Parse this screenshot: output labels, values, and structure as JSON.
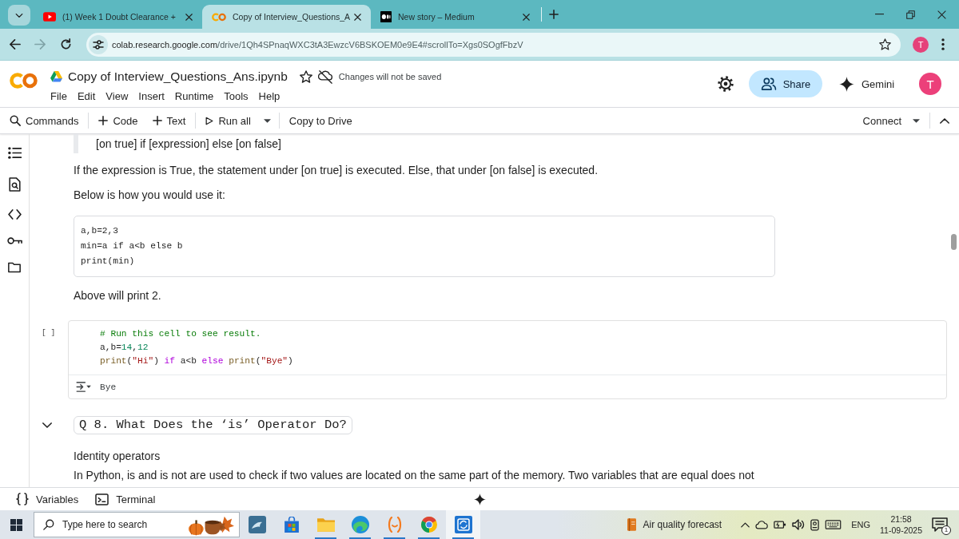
{
  "browser": {
    "tabs": [
      {
        "kind": "video",
        "title": "(1) Week 1 Doubt Clearance +",
        "selected": false
      },
      {
        "kind": "notebook",
        "title": "Copy of Interview_Questions_A",
        "selected": true
      },
      {
        "kind": "story",
        "title": "New story – Medium",
        "selected": false
      }
    ],
    "nav": [
      {
        "kind": "back",
        "disabled": false
      },
      {
        "kind": "forward",
        "disabled": true
      },
      {
        "kind": "reload",
        "disabled": false
      }
    ],
    "address": {
      "host": "colab.research.google.com",
      "path": "/drive/1Qh4SPnaqWXC3tA3EwzcV6BSKOEM0e9E4#scrollTo=Xgs0SOgfFbzV"
    },
    "profile_initial": "T"
  },
  "notebook": {
    "title": "Copy of Interview_Questions_Ans.ipynb",
    "save_status": "Changes will not be saved",
    "menu": [
      "File",
      "Edit",
      "View",
      "Insert",
      "Runtime",
      "Tools",
      "Help"
    ],
    "share": "Share",
    "gemini": "Gemini",
    "avatar_initial": "T"
  },
  "toolbar": {
    "groups": [
      [
        {
          "kind": "commands",
          "label": "Commands"
        }
      ],
      [
        {
          "kind": "code",
          "label": "Code"
        },
        {
          "kind": "text",
          "label": "Text"
        }
      ],
      [
        {
          "kind": "run",
          "label": "Run all",
          "menu": true
        }
      ],
      [
        {
          "kind": "copy",
          "label": "Copy to Drive"
        }
      ]
    ],
    "connect": "Connect"
  },
  "cells": [
    {
      "kind": "quote",
      "text": "[on true] if [expression] else [on false]"
    },
    {
      "kind": "text",
      "lines": [
        "If the expression is True, the statement under [on true] is executed. Else, that under [on false] is executed."
      ]
    },
    {
      "kind": "text",
      "lines": [
        "Below is how you would use it:"
      ]
    },
    {
      "kind": "code_block",
      "lines": [
        "a,b=2,3",
        "min=a if a<b else b",
        "print(min)"
      ]
    },
    {
      "kind": "text",
      "lines": [
        "Above will print 2."
      ]
    },
    {
      "kind": "code_cell",
      "run_label": "[ ]",
      "lines": [
        {
          "tokens": [
            {
              "text": "# Run this cell to see result.",
              "kind": "comment"
            }
          ]
        },
        {
          "tokens": [
            {
              "text": "a,b=",
              "kind": "plain"
            },
            {
              "text": "14",
              "kind": "number"
            },
            {
              "text": ",",
              "kind": "plain"
            },
            {
              "text": "12",
              "kind": "number"
            }
          ]
        },
        {
          "tokens": [
            {
              "text": "print",
              "kind": "builtin"
            },
            {
              "text": "(",
              "kind": "plain"
            },
            {
              "text": "\"Hi\"",
              "kind": "string"
            },
            {
              "text": ") ",
              "kind": "plain"
            },
            {
              "text": "if",
              "kind": "keyword"
            },
            {
              "text": " a<b ",
              "kind": "plain"
            },
            {
              "text": "else",
              "kind": "keyword"
            },
            {
              "text": " print",
              "kind": "builtin"
            },
            {
              "text": "(",
              "kind": "plain"
            },
            {
              "text": "\"Bye\"",
              "kind": "string"
            },
            {
              "text": ")",
              "kind": "plain"
            }
          ]
        }
      ],
      "output": "Bye"
    },
    {
      "kind": "heading",
      "expanded": true,
      "text": "Q 8. What Does the ‘is’ Operator Do?"
    },
    {
      "kind": "text",
      "lines": [
        "Identity operators",
        "In Python, is and is not are used to check if two values are located on the same part of the memory. Two variables that are equal does not"
      ]
    }
  ],
  "bottom_bar": {
    "items": [
      {
        "kind": "variables",
        "label": "Variables"
      },
      {
        "kind": "terminal",
        "label": "Terminal"
      }
    ]
  },
  "taskbar": {
    "search_placeholder": "Type here to search",
    "apps": [
      {
        "kind": "dolphin",
        "running": false,
        "selected": false
      },
      {
        "kind": "store",
        "running": false,
        "selected": false
      },
      {
        "kind": "folder",
        "running": true,
        "selected": false
      },
      {
        "kind": "swirl",
        "running": true,
        "selected": false
      },
      {
        "kind": "bracket",
        "running": true,
        "selected": false
      },
      {
        "kind": "tricolor",
        "running": true,
        "selected": false
      },
      {
        "kind": "sync",
        "running": true,
        "selected": true
      }
    ],
    "widget": "Air quality forecast",
    "language": "ENG",
    "time": "21:58",
    "date": "11-09-2025",
    "notifications": "1"
  }
}
